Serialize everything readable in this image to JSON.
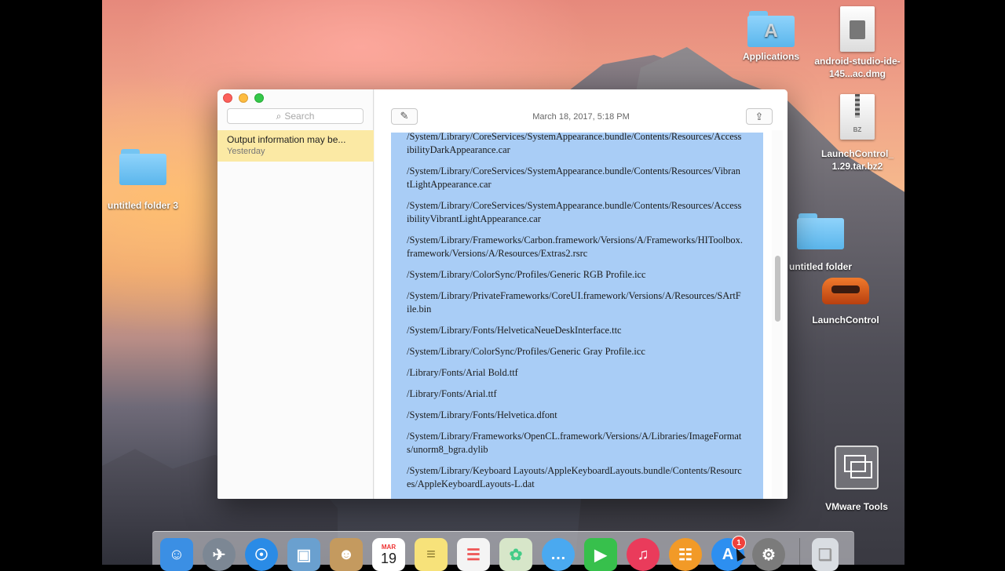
{
  "desktop": {
    "icons": [
      {
        "label": "Applications",
        "icon": "applications-folder-icon"
      },
      {
        "label": "android-studio-ide-145...ac.dmg",
        "icon": "disk-image-icon"
      },
      {
        "label": "untitled folder 3",
        "icon": "folder-icon"
      },
      {
        "label": "LaunchControl_1.29.tar.bz2",
        "icon": "archive-icon"
      },
      {
        "label": "untitled folder",
        "icon": "folder-icon"
      },
      {
        "label": "LaunchControl",
        "icon": "launchcontrol-app-icon"
      },
      {
        "label": "VMware Tools",
        "icon": "vmware-tools-icon"
      }
    ],
    "labels": {
      "applications": "Applications",
      "android_dmg": "android-studio-ide-145...ac.dmg",
      "untitled3": "untitled folder 3",
      "launchcontrol_bz2": "LaunchControl_ 1.29.tar.bz2",
      "untitled": "untitled folder",
      "launchcontrol": "LaunchControl",
      "vmware": "VMware Tools",
      "bz_tag": "BZ"
    }
  },
  "notes": {
    "search_placeholder": "Search",
    "note_list": [
      {
        "title": "Output information may be...",
        "date": "Yesterday"
      }
    ],
    "timestamp": "March 18, 2017, 5:18 PM",
    "lines": [
      "/System/Library/CoreServices/SystemAppearance.bundle/Contents/Resources/AccessibilityDarkAppearance.car",
      "/System/Library/CoreServices/SystemAppearance.bundle/Contents/Resources/VibrantLightAppearance.car",
      "/System/Library/CoreServices/SystemAppearance.bundle/Contents/Resources/AccessibilityVibrantLightAppearance.car",
      "/System/Library/Frameworks/Carbon.framework/Versions/A/Frameworks/HIToolbox.framework/Versions/A/Resources/Extras2.rsrc",
      "/System/Library/ColorSync/Profiles/Generic RGB Profile.icc",
      "/System/Library/PrivateFrameworks/CoreUI.framework/Versions/A/Resources/SArtFile.bin",
      "/System/Library/Fonts/HelveticaNeueDeskInterface.ttc",
      "/System/Library/ColorSync/Profiles/Generic Gray Profile.icc",
      "/Library/Fonts/Arial Bold.ttf",
      "/Library/Fonts/Arial.ttf",
      "/System/Library/Fonts/Helvetica.dfont",
      "/System/Library/Frameworks/OpenCL.framework/Versions/A/Libraries/ImageFormats/unorm8_bgra.dylib",
      "/System/Library/Keyboard Layouts/AppleKeyboardLayouts.bundle/Contents/Resources/AppleKeyboardLayouts-L.dat"
    ]
  },
  "dock": {
    "apps": [
      {
        "name": "Finder",
        "icon": "finder-icon",
        "color": "#3b8fe4"
      },
      {
        "name": "Launchpad",
        "icon": "launchpad-icon",
        "color": "#7c8794"
      },
      {
        "name": "Safari",
        "icon": "safari-icon",
        "color": "#2a8be6"
      },
      {
        "name": "Preview",
        "icon": "preview-icon",
        "color": "#6aa0cf"
      },
      {
        "name": "Contacts",
        "icon": "contacts-icon",
        "color": "#c49a5f"
      },
      {
        "name": "Calendar",
        "icon": "calendar-icon",
        "color": "#ffffff"
      },
      {
        "name": "Notes",
        "icon": "notes-icon",
        "color": "#f7e27a"
      },
      {
        "name": "Reminders",
        "icon": "reminders-icon",
        "color": "#f4f4f4"
      },
      {
        "name": "Photos",
        "icon": "photos-icon",
        "color": "#d7e6c9"
      },
      {
        "name": "Messages",
        "icon": "messages-icon",
        "color": "#4aa9f0"
      },
      {
        "name": "FaceTime",
        "icon": "facetime-icon",
        "color": "#37c04c"
      },
      {
        "name": "iTunes",
        "icon": "itunes-icon",
        "color": "#ea3b5b"
      },
      {
        "name": "iBooks",
        "icon": "ibooks-icon",
        "color": "#f29a27"
      },
      {
        "name": "App Store",
        "icon": "app-store-icon",
        "color": "#2d8ff0"
      },
      {
        "name": "System Preferences",
        "icon": "system-preferences-icon",
        "color": "#7b7b7b"
      },
      {
        "name": "Trash",
        "icon": "trash-icon",
        "color": "#d9dde2"
      }
    ],
    "calendar_month": "MAR",
    "calendar_day": "19",
    "app_store_badge": "1"
  }
}
